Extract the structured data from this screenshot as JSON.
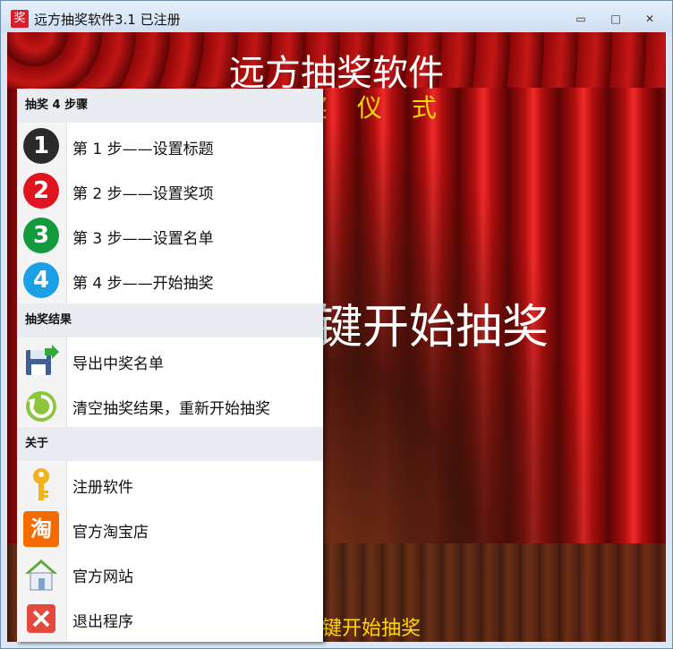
{
  "window": {
    "title": "远方抽奖软件3.1 已注册",
    "app_icon": "奖",
    "controls": {
      "minimize": "▭",
      "maximize": "□",
      "close": "✕"
    }
  },
  "stage": {
    "title": "远方抽奖软件",
    "subtitle": "奖 仪 式",
    "main": "键开始抽奖",
    "hint": "格键开始抽奖"
  },
  "menu": {
    "sections": [
      {
        "header": "抽奖 4 步骤",
        "items": [
          {
            "icon": "number-1-icon",
            "glyph": "1",
            "color": "#2a2a2a",
            "label": "第 1 步——设置标题"
          },
          {
            "icon": "number-2-icon",
            "glyph": "2",
            "color": "#e0141e",
            "label": "第 2 步——设置奖项"
          },
          {
            "icon": "number-3-icon",
            "glyph": "3",
            "color": "#129a3c",
            "label": "第 3 步——设置名单"
          },
          {
            "icon": "number-4-icon",
            "glyph": "4",
            "color": "#1aa0e6",
            "label": "第 4 步——开始抽奖"
          }
        ]
      },
      {
        "header": "抽奖结果",
        "items": [
          {
            "icon": "export-save-icon",
            "label": "导出中奖名单"
          },
          {
            "icon": "refresh-icon",
            "label": "清空抽奖结果，重新开始抽奖"
          }
        ]
      },
      {
        "header": "关于",
        "items": [
          {
            "icon": "key-icon",
            "label": "注册软件"
          },
          {
            "icon": "taobao-icon",
            "glyph": "淘",
            "label": "官方淘宝店"
          },
          {
            "icon": "home-icon",
            "label": "官方网站"
          },
          {
            "icon": "exit-icon",
            "label": "退出程序"
          }
        ]
      }
    ]
  }
}
